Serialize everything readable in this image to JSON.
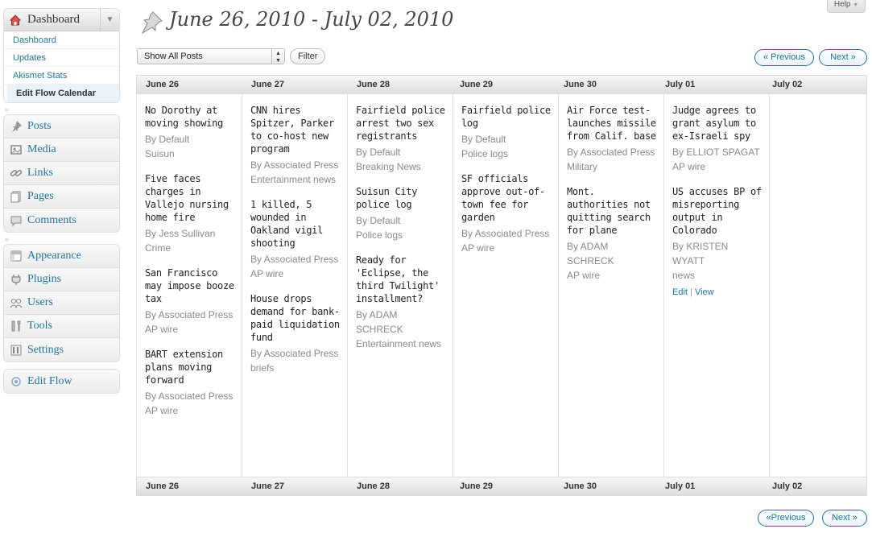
{
  "sidebar": {
    "dashboard": {
      "label": "Dashboard",
      "submenu": [
        "Dashboard",
        "Updates",
        "Akismet Stats",
        "Edit Flow Calendar"
      ]
    },
    "group1": [
      {
        "label": "Posts",
        "icon": "pushpin-icon"
      },
      {
        "label": "Media",
        "icon": "media-icon"
      },
      {
        "label": "Links",
        "icon": "link-icon"
      },
      {
        "label": "Pages",
        "icon": "pages-icon"
      },
      {
        "label": "Comments",
        "icon": "comment-icon"
      }
    ],
    "group2": [
      {
        "label": "Appearance",
        "icon": "appearance-icon"
      },
      {
        "label": "Plugins",
        "icon": "plugin-icon"
      },
      {
        "label": "Users",
        "icon": "users-icon"
      },
      {
        "label": "Tools",
        "icon": "tools-icon"
      },
      {
        "label": "Settings",
        "icon": "settings-icon"
      }
    ],
    "group3": [
      {
        "label": "Edit Flow",
        "icon": "edit-flow-icon"
      }
    ]
  },
  "header": {
    "title": "June 26, 2010 - July 02, 2010",
    "help_label": "Help"
  },
  "controls": {
    "filter_select": "Show All Posts",
    "filter_button": "Filter",
    "prev_top": "« Previous",
    "next_top": "Next »",
    "prev_bottom": "«Previous",
    "next_bottom": "Next »"
  },
  "days": [
    "June 26",
    "June 27",
    "June 28",
    "June 29",
    "June 30",
    "July 01",
    "July 02"
  ],
  "columns": [
    [
      {
        "title": "No Dorothy at moving showing",
        "meta": [
          "By Default",
          "Suisun"
        ]
      },
      {
        "title": "Five faces charges in Vallejo nursing home fire",
        "meta": [
          "By Jess Sullivan",
          "Crime"
        ]
      },
      {
        "title": "San Francisco may impose booze tax",
        "meta": [
          "By Associated Press",
          "AP wire"
        ]
      },
      {
        "title": "BART extension plans moving forward",
        "meta": [
          "By Associated Press",
          "AP wire"
        ]
      }
    ],
    [
      {
        "title": "CNN hires Spitzer, Parker to co-host new program",
        "meta": [
          "By Associated Press",
          "Entertainment news"
        ]
      },
      {
        "title": "1 killed, 5 wounded in Oakland vigil shooting",
        "meta": [
          "By Associated Press",
          "AP wire"
        ]
      },
      {
        "title": "House drops demand for bank-paid liquidation fund",
        "meta": [
          "By Associated Press",
          "briefs"
        ]
      }
    ],
    [
      {
        "title": "Fairfield police arrest two sex registrants",
        "meta": [
          "By Default",
          "Breaking News"
        ]
      },
      {
        "title": "Suisun City police log",
        "meta": [
          "By Default",
          "Police logs"
        ]
      },
      {
        "title": "Ready for 'Eclipse, the third Twilight' installment?",
        "meta": [
          "By ADAM SCHRECK",
          "Entertainment news"
        ]
      }
    ],
    [
      {
        "title": "Fairfield police log",
        "meta": [
          "By Default",
          "Police logs"
        ]
      },
      {
        "title": "SF officials approve out-of-town fee for garden",
        "meta": [
          "By Associated Press",
          "AP wire"
        ]
      }
    ],
    [
      {
        "title": "Air Force test-launches missile from Calif. base",
        "meta": [
          "By Associated Press",
          "Military"
        ]
      },
      {
        "title": "Mont. authorities not quitting search for plane",
        "meta": [
          "By ADAM SCHRECK",
          "AP wire"
        ]
      }
    ],
    [
      {
        "title": "Judge agrees to grant asylum to ex-Israeli spy",
        "meta": [
          "By ELLIOT SPAGAT",
          "AP wire"
        ]
      },
      {
        "title": "US accuses BP of misreporting output in Colorado",
        "meta": [
          "By KRISTEN WYATT",
          "news"
        ],
        "links": {
          "edit": "Edit",
          "sep": "|",
          "view": "View"
        }
      }
    ],
    []
  ]
}
